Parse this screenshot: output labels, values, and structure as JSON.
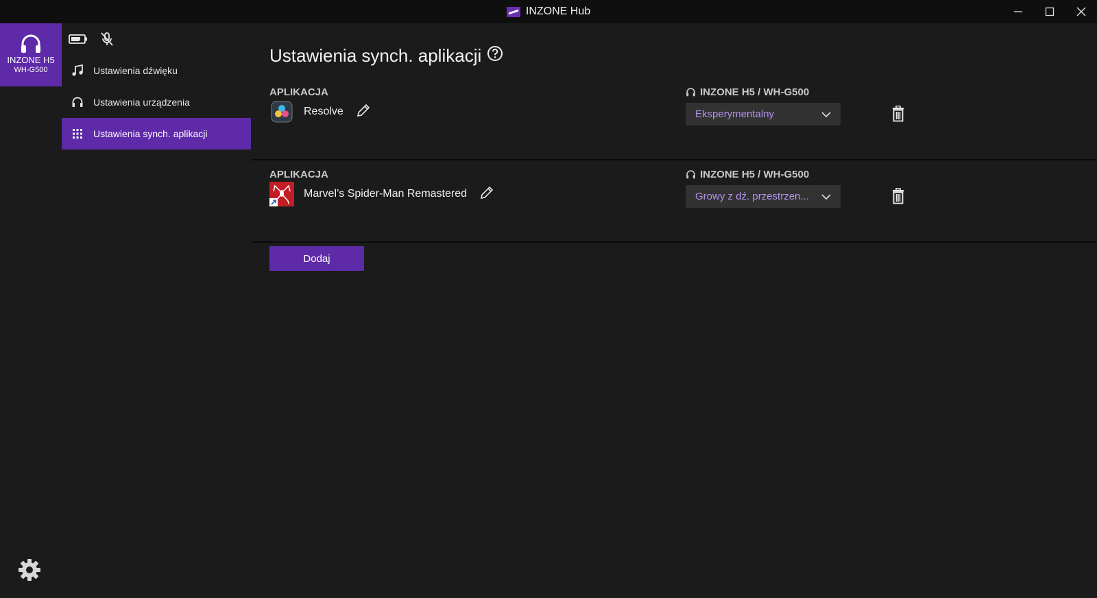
{
  "window": {
    "title": "INZONE Hub",
    "controls": [
      "minimize-icon",
      "maximize-icon",
      "close-icon"
    ]
  },
  "rail": {
    "device_name": "INZONE H5",
    "device_model": "WH-G500",
    "icon": "headphones-icon",
    "settings_icon": "gear-icon"
  },
  "status": {
    "battery_icon": "battery-icon",
    "mic_icon": "mic-muted-icon"
  },
  "nav": {
    "items": [
      {
        "label": "Ustawienia dźwięku",
        "icon": "music-note-icon"
      },
      {
        "label": "Ustawienia urządzenia",
        "icon": "headphones-icon"
      },
      {
        "label": "Ustawienia synch. aplikacji",
        "icon": "grid-icon",
        "active": true
      }
    ]
  },
  "page": {
    "title": "Ustawienia synch. aplikacji",
    "help_icon": "help-circle-icon"
  },
  "rows": [
    {
      "app_header": "APLIKACJA",
      "app_name": "Resolve",
      "device_header": "INZONE H5 / WH-G500",
      "profile": "Eksperymentalny"
    },
    {
      "app_header": "APLIKACJA",
      "app_name": "Marvel’s Spider-Man Remastered",
      "device_header": "INZONE H5 / WH-G500",
      "profile": "Growy z dź. przestrzen..."
    }
  ],
  "actions": {
    "add_label": "Dodaj"
  },
  "colors": {
    "accent": "#5e2aa8",
    "dropdown_text": "#b493f0",
    "background": "#1b1b1b",
    "titlebar": "#0f0f0f"
  }
}
